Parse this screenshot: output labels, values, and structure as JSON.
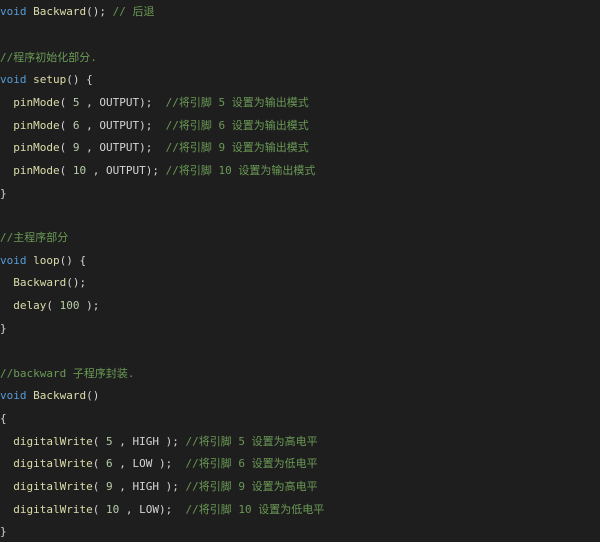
{
  "code_lines": [
    "void Backward(); // 后退",
    "//程序初始化部分.",
    "void setup() {",
    "  pinMode( 5 , OUTPUT);  //将引脚 5 设置为输出模式",
    "  pinMode( 6 , OUTPUT);  //将引脚 6 设置为输出模式",
    "  pinMode( 9 , OUTPUT);  //将引脚 9 设置为输出模式",
    "  pinMode( 10 , OUTPUT); //将引脚 10 设置为输出模式",
    "}",
    "//主程序部分",
    "void loop() {",
    "  Backward();",
    "  delay( 100 );",
    "}",
    "//backward 子程序封装.",
    "void Backward()",
    "{",
    "  digitalWrite( 5 , HIGH ); //将引脚 5 设置为高电平",
    "  digitalWrite( 6 , LOW );  //将引脚 6 设置为低电平",
    "  digitalWrite( 9 , HIGH ); //将引脚 9 设置为高电平",
    "  digitalWrite( 10 , LOW);  //将引脚 10 设置为低电平",
    "}"
  ],
  "colors": {
    "background": "#1e1e1e",
    "keyword": "#569cd6",
    "comment": "#6a9955",
    "text": "#d4d4d4"
  }
}
